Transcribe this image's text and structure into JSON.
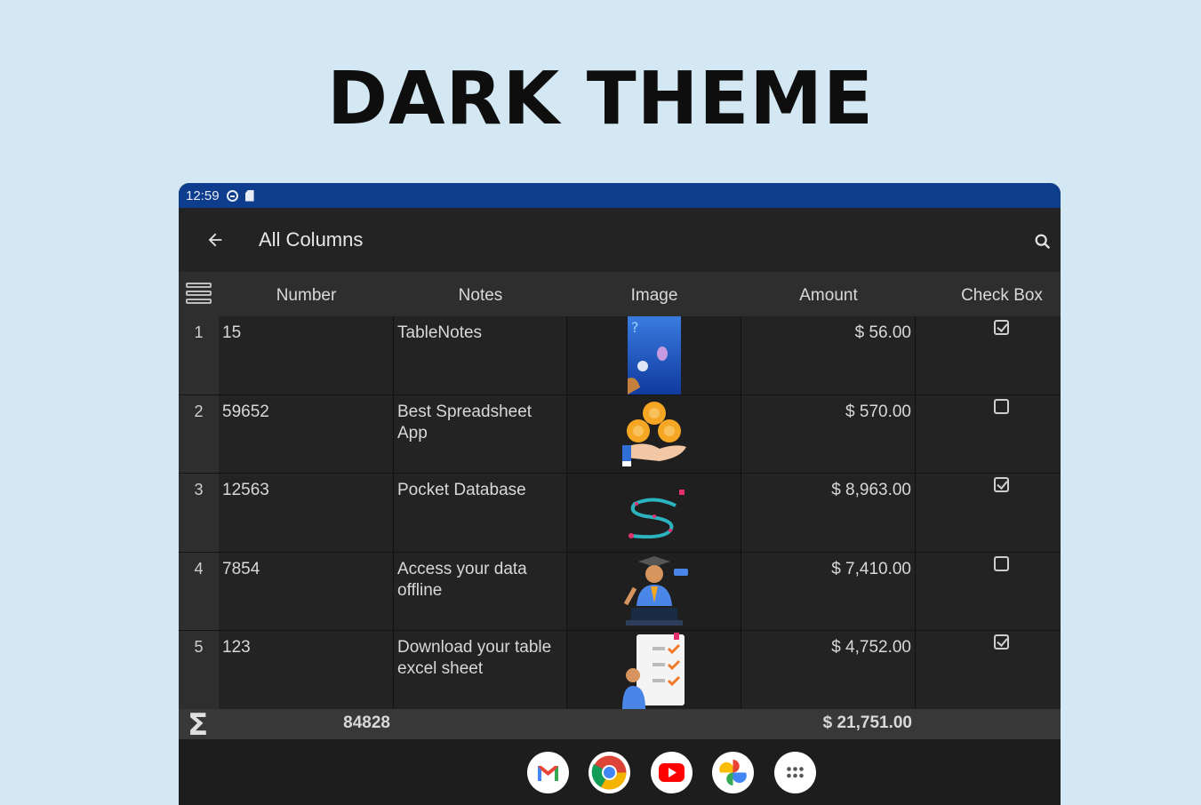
{
  "headline": "DARK THEME",
  "status": {
    "time": "12:59"
  },
  "appbar": {
    "title": "All Columns"
  },
  "columns": [
    "Number",
    "Notes",
    "Image",
    "Amount",
    "Check Box"
  ],
  "rows": [
    {
      "index": "1",
      "number": "15",
      "notes": "TableNotes",
      "amount": "$ 56.00",
      "checked": true,
      "image": "phone-illustration"
    },
    {
      "index": "2",
      "number": "59652",
      "notes": "Best  Spreadsheet App",
      "amount": "$ 570.00",
      "checked": false,
      "image": "hand-coins-illustration"
    },
    {
      "index": "3",
      "number": "12563",
      "notes": "Pocket Database",
      "amount": "$ 8,963.00",
      "checked": true,
      "image": "route-path-illustration"
    },
    {
      "index": "4",
      "number": "7854",
      "notes": "Access your data offline",
      "amount": "$ 7,410.00",
      "checked": false,
      "image": "graduate-laptop-illustration"
    },
    {
      "index": "5",
      "number": "123",
      "notes": "Download your table excel sheet",
      "amount": "$ 4,752.00",
      "checked": true,
      "image": "checklist-person-illustration"
    }
  ],
  "totals": {
    "number": "84828",
    "amount": "$ 21,751.00"
  },
  "dock": [
    "gmail-icon",
    "chrome-icon",
    "youtube-icon",
    "photos-icon",
    "app-launcher-icon"
  ],
  "colors": {
    "statusbar": "#0d3d8c",
    "background": "#d3e8f3",
    "surface": "#232323"
  }
}
